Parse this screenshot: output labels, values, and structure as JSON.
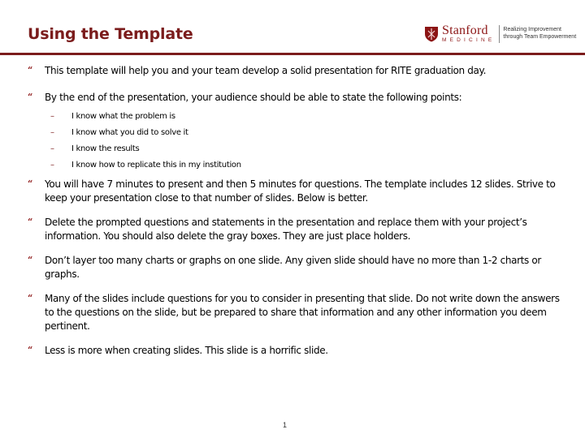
{
  "header": {
    "title": "Using the Template",
    "accent_color": "#7b1c1c",
    "logo": {
      "wordmark": "Stanford",
      "subword": "MEDICINE",
      "tagline_line1": "Realizing Improvement",
      "tagline_line2": "through Team Empowerment",
      "icon": "stanford-shield-icon"
    }
  },
  "bullets": [
    {
      "text": "This template will help you and your team develop a solid presentation for RITE graduation day."
    },
    {
      "text": "By the end of the presentation, your audience should be able to state the following points:",
      "subitems": [
        "I know what the problem is",
        "I know what you did to solve it",
        "I know the results",
        "I know how to replicate this in my institution"
      ]
    },
    {
      "text": "You will have 7 minutes to present and then 5 minutes for questions. The template includes 12 slides. Strive to keep your presentation close to that number of slides. Below is better."
    },
    {
      "text": "Delete the prompted questions and statements in the presentation and replace them with your project’s information. You should also delete the gray boxes. They are just place holders."
    },
    {
      "text": "Don’t layer too many charts or graphs on one slide. Any given slide should have no more than 1-2 charts or graphs."
    },
    {
      "text": "Many of the slides include questions for you to consider in presenting that slide. Do not write down the answers to the questions on the slide, but be prepared to share that information and any other information you deem pertinent."
    },
    {
      "text": "Less is more when creating slides. This slide is a horrific slide."
    }
  ],
  "bullet_glyph": "“",
  "sub_glyph": "–",
  "footer": {
    "page_number": "1"
  }
}
